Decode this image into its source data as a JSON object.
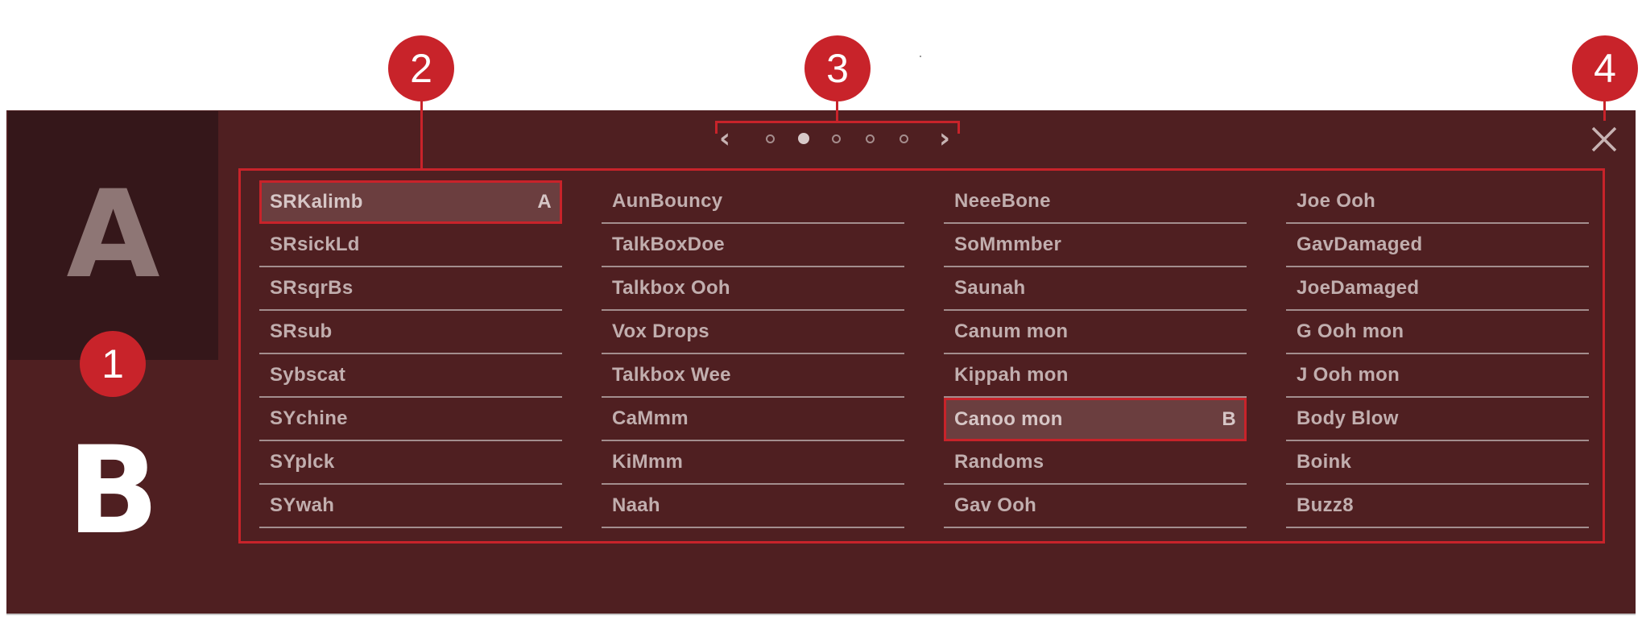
{
  "slots": {
    "a_label": "A",
    "b_label": "B"
  },
  "callouts": [
    "1",
    "2",
    "3",
    "4"
  ],
  "pager": {
    "prev_icon": "chevron-left-icon",
    "next_icon": "chevron-right-icon",
    "prev_glyph": "‹",
    "next_glyph": "›",
    "page_count": 5,
    "active_page": 2
  },
  "close": {
    "icon": "close-icon"
  },
  "columns": [
    [
      {
        "label": "SRKalimb",
        "slot": "A"
      },
      {
        "label": "SRsickLd"
      },
      {
        "label": "SRsqrBs"
      },
      {
        "label": "SRsub"
      },
      {
        "label": "Sybscat"
      },
      {
        "label": "SYchine"
      },
      {
        "label": "SYplck"
      },
      {
        "label": "SYwah"
      }
    ],
    [
      {
        "label": "AunBouncy"
      },
      {
        "label": "TalkBoxDoe"
      },
      {
        "label": "Talkbox Ooh"
      },
      {
        "label": "Vox Drops"
      },
      {
        "label": "Talkbox Wee"
      },
      {
        "label": "CaMmm"
      },
      {
        "label": "KiMmm"
      },
      {
        "label": "Naah"
      }
    ],
    [
      {
        "label": "NeeeBone"
      },
      {
        "label": "SoMmmber"
      },
      {
        "label": "Saunah"
      },
      {
        "label": "Canum mon"
      },
      {
        "label": "Kippah mon"
      },
      {
        "label": "Canoo mon",
        "slot": "B"
      },
      {
        "label": "Randoms"
      },
      {
        "label": "Gav Ooh"
      }
    ],
    [
      {
        "label": "Joe Ooh"
      },
      {
        "label": "GavDamaged"
      },
      {
        "label": "JoeDamaged"
      },
      {
        "label": "G Ooh mon"
      },
      {
        "label": "J Ooh mon"
      },
      {
        "label": "Body Blow"
      },
      {
        "label": "Boink"
      },
      {
        "label": "Buzz8"
      }
    ]
  ],
  "colors": {
    "panel": "#4f1f21",
    "slot_a_bg": "#35171a",
    "accent": "#c8232a",
    "text": "#c1aeae"
  }
}
